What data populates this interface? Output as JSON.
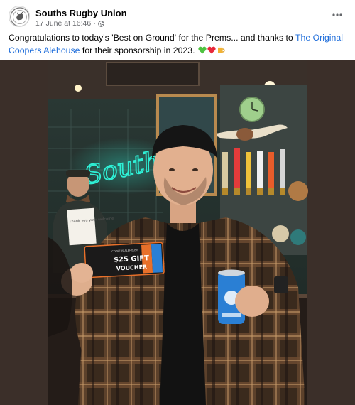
{
  "post": {
    "author": "Souths Rugby Union",
    "timestamp": "17 June at 16:46",
    "separator": "·",
    "audience_icon": "globe-icon",
    "more_icon": "more-options-icon",
    "caption_pre": "Congratulations to today's 'Best on Ground' for the Prems... and thanks to ",
    "sponsor_link": "The Original Coopers Alehouse",
    "caption_post": " for their sponsorship in 2023. ",
    "emojis": [
      "green-heart-emoji",
      "red-heart-emoji",
      "beer-emoji"
    ]
  },
  "photo": {
    "neon_sign": "Souths",
    "voucher_amount": "$25 GIFT",
    "voucher_word": "VOUCHER",
    "voucher_brand": "COOPERS ALEHOUSE",
    "note_text": "Thank you your welcome",
    "colors": {
      "neon": "#2ef0d6",
      "shirt_dark": "#3b2a1c",
      "can_blue": "#2a7fd4",
      "voucher_orange": "#e8702a"
    }
  }
}
